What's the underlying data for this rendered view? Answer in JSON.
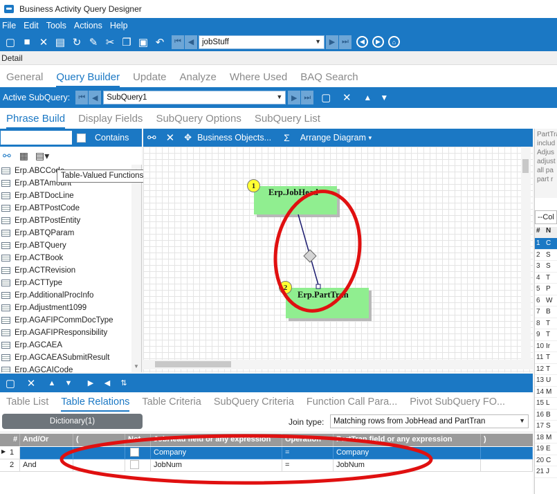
{
  "app": {
    "title": "Business Activity Query Designer"
  },
  "menu": [
    "File",
    "Edit",
    "Tools",
    "Actions",
    "Help"
  ],
  "toolbar": {
    "record_value": "jobStuff"
  },
  "detail_label": "Detail",
  "main_tabs": [
    {
      "label": "General"
    },
    {
      "label": "Query Builder",
      "active": true
    },
    {
      "label": "Update"
    },
    {
      "label": "Analyze"
    },
    {
      "label": "Where Used"
    },
    {
      "label": "BAQ Search"
    }
  ],
  "subquery": {
    "label": "Active SubQuery:",
    "value": "SubQuery1"
  },
  "sub_tabs": [
    {
      "label": "Phrase Build",
      "active": true
    },
    {
      "label": "Display Fields"
    },
    {
      "label": "SubQuery Options"
    },
    {
      "label": "SubQuery List"
    }
  ],
  "search": {
    "contains_label": "Contains"
  },
  "tooltip": "Table-Valued Functions",
  "tables": [
    "Erp.ABCCode",
    "Erp.ABTAmount",
    "Erp.ABTDocLine",
    "Erp.ABTPostCode",
    "Erp.ABTPostEntity",
    "Erp.ABTQParam",
    "Erp.ABTQuery",
    "Erp.ACTBook",
    "Erp.ACTRevision",
    "Erp.ACTType",
    "Erp.AdditionalProcInfo",
    "Erp.Adjustment1099",
    "Erp.AGAFIPCommDocType",
    "Erp.AGAFIPResponsibility",
    "Erp.AGCAEA",
    "Erp.AGCAEASubmitResult",
    "Erp.AGCAICode"
  ],
  "diagram_toolbar": {
    "business_objects": "Business Objects...",
    "sigma": "Σ",
    "arrange": "Arrange Diagram"
  },
  "nodes": [
    {
      "num": "1",
      "name": "Erp.JobHead"
    },
    {
      "num": "2",
      "name": "Erp.PartTran"
    }
  ],
  "right_panel": {
    "text_lines": [
      "PartTra",
      "includ",
      "Adjus",
      "adjust",
      "all pa",
      "part r"
    ],
    "col_header": "--Col",
    "hash": "#",
    "n": "N",
    "rows": [
      {
        "n": "1",
        "v": "C"
      },
      {
        "n": "2",
        "v": "S"
      },
      {
        "n": "3",
        "v": "S"
      },
      {
        "n": "4",
        "v": "T"
      },
      {
        "n": "5",
        "v": "P"
      },
      {
        "n": "6",
        "v": "W"
      },
      {
        "n": "7",
        "v": "B"
      },
      {
        "n": "8",
        "v": "T"
      },
      {
        "n": "9",
        "v": "T"
      },
      {
        "n": "10",
        "v": "Ir"
      },
      {
        "n": "11",
        "v": "T"
      },
      {
        "n": "12",
        "v": "T"
      },
      {
        "n": "13",
        "v": "U"
      },
      {
        "n": "14",
        "v": "M"
      },
      {
        "n": "15",
        "v": "L"
      },
      {
        "n": "16",
        "v": "B"
      },
      {
        "n": "17",
        "v": "S"
      },
      {
        "n": "18",
        "v": "M"
      },
      {
        "n": "19",
        "v": "E"
      },
      {
        "n": "20",
        "v": "C"
      },
      {
        "n": "21",
        "v": "J"
      }
    ]
  },
  "bottom_tabs": [
    {
      "label": "Table List"
    },
    {
      "label": "Table Relations",
      "active": true
    },
    {
      "label": "Table Criteria"
    },
    {
      "label": "SubQuery Criteria"
    },
    {
      "label": "Function Call Para..."
    },
    {
      "label": "Pivot SubQuery FO..."
    }
  ],
  "dictionary_button": "Dictionary(1)",
  "join": {
    "label": "Join type:",
    "value": "Matching rows from JobHead and PartTran"
  },
  "grid": {
    "headers": [
      "#",
      "And/Or",
      "(",
      "Not",
      "JobHead field or any expression",
      "Operation",
      "PartTran field or any expression",
      ")"
    ],
    "rows": [
      {
        "num": "1",
        "andor": "",
        "open": "",
        "left": "Company",
        "op": "=",
        "right": "Company",
        "close": "",
        "selected": true
      },
      {
        "num": "2",
        "andor": "And",
        "open": "",
        "left": "JobNum",
        "op": "=",
        "right": "JobNum",
        "close": "",
        "selected": false
      }
    ]
  },
  "colors": {
    "accent": "#1b78c4",
    "annotation": "#e01010",
    "node": "#90ee90"
  }
}
